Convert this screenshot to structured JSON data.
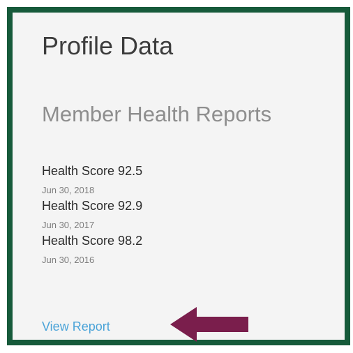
{
  "profile": {
    "title": "Profile Data",
    "section_title": "Member Health Reports",
    "reports": [
      {
        "score_label": "Health Score 92.5",
        "date": "Jun 30, 2018"
      },
      {
        "score_label": "Health Score 92.9",
        "date": "Jun 30, 2017"
      },
      {
        "score_label": "Health Score 98.2",
        "date": "Jun 30, 2016"
      }
    ],
    "view_report_link": "View Report"
  },
  "colors": {
    "border": "#165a3a",
    "panel_background": "#f4f4f4",
    "link": "#4aa3d8",
    "arrow": "#7a1e4c"
  },
  "icons": {
    "arrow": "left-arrow-icon"
  }
}
